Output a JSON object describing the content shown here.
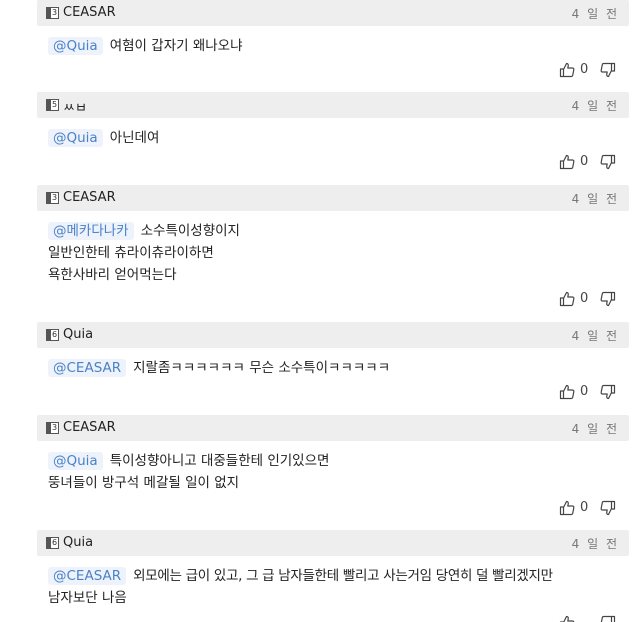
{
  "comments": [
    {
      "level": "3",
      "author": "CEASAR",
      "date": "4 일 전",
      "mention": "@Quia",
      "lines": [
        "여혐이 갑자기 왜나오냐"
      ],
      "upvotes": "0"
    },
    {
      "level": "5",
      "author": "ㅆㅂ",
      "date": "4 일 전",
      "mention": "@Quia",
      "lines": [
        "아닌데여"
      ],
      "upvotes": "0"
    },
    {
      "level": "3",
      "author": "CEASAR",
      "date": "4 일 전",
      "mention": "@메카다나카",
      "lines": [
        "소수특이성향이지",
        "일반인한테 츄라이츄라이하면",
        "욕한사바리 얻어먹는다"
      ],
      "upvotes": "0"
    },
    {
      "level": "6",
      "author": "Quia",
      "date": "4 일 전",
      "mention": "@CEASAR",
      "lines": [
        "지랄좀ㅋㅋㅋㅋㅋㅋ 무슨 소수특이ㅋㅋㅋㅋㅋ"
      ],
      "upvotes": "0"
    },
    {
      "level": "3",
      "author": "CEASAR",
      "date": "4 일 전",
      "mention": "@Quia",
      "lines": [
        "특이성향아니고 대중들한테 인기있으면",
        "뚱녀들이 방구석 메갈될 일이 없지"
      ],
      "upvotes": "0"
    },
    {
      "level": "6",
      "author": "Quia",
      "date": "4 일 전",
      "mention": "@CEASAR",
      "lines": [
        "외모에는 급이 있고, 그 급 남자들한테 빨리고 사는거임 당연히 덜 빨리겠지만",
        "남자보단 나음"
      ],
      "upvotes": ""
    }
  ]
}
